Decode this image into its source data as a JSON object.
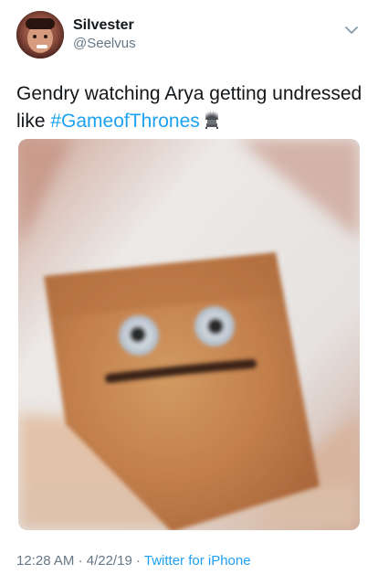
{
  "tweet": {
    "display_name": "Silvester",
    "handle": "@Seelvus",
    "text": "Gendry watching Arya getting undressed like",
    "hashtag": "#GameofThrones",
    "time": "12:28 AM",
    "separator1": "·",
    "date": "4/22/19",
    "separator2": "·",
    "source": "Twitter for iPhone"
  },
  "icons": {
    "more": "chevron-down-icon",
    "emoji": "throne-icon"
  },
  "colors": {
    "link": "#1da1f2",
    "secondary_text": "#657786",
    "primary_text": "#14171a"
  }
}
